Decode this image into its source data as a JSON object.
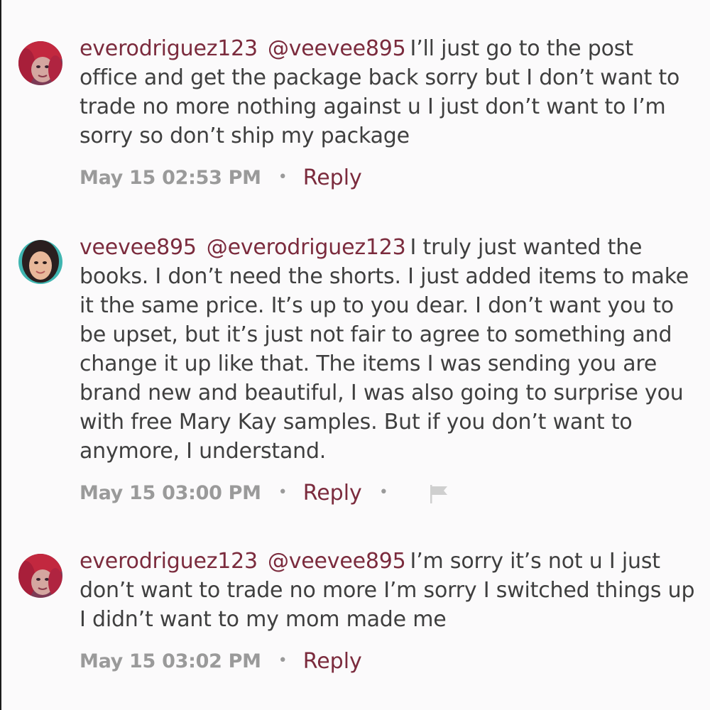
{
  "comments": [
    {
      "username": "everodriguez123",
      "mention": "@veevee895",
      "text": "I’ll just go to the post office and get the package back sorry but I don’t want to trade no more nothing against u I just don’t want to I’m sorry so don’t ship my package",
      "timestamp": "May 15 02:53 PM",
      "separator": "•",
      "reply_label": "Reply",
      "avatar": "avatar-red-hair-icon"
    },
    {
      "username": "veevee895",
      "mention": "@everodriguez123",
      "text": "I truly just wanted the books. I don’t need the shorts. I just added items to make it the same price. It’s up to you dear. I don’t want you to be upset, but it’s just not fair to agree to something and change it up like that. The items I was sending you are brand new and beautiful, I was also going to surprise you with free Mary Kay samples. But if you don’t want to anymore, I understand.",
      "timestamp": "May 15 03:00 PM",
      "separator": "•",
      "reply_label": "Reply",
      "separator2": "•",
      "flag_icon": "flag-icon",
      "avatar": "avatar-teal-icon"
    },
    {
      "username": "everodriguez123",
      "mention": "@veevee895",
      "text": "I’m sorry it’s not u I just don’t want to trade no more I’m sorry I switched things up I didn’t want to my mom made me",
      "timestamp": "May 15 03:02 PM",
      "separator": "•",
      "reply_label": "Reply",
      "avatar": "avatar-red-hair-icon"
    }
  ]
}
